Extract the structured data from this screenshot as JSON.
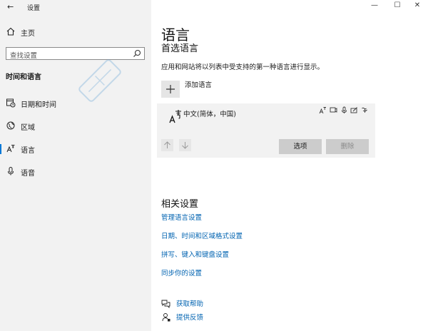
{
  "window": {
    "title": "设置",
    "back_glyph": "←",
    "minimize_glyph": "—",
    "maximize_glyph": "☐",
    "close_glyph": "✕"
  },
  "sidebar": {
    "home_label": "主页",
    "search_placeholder": "查找设置",
    "group_heading": "时间和语言",
    "items": [
      {
        "label": "日期和时间",
        "icon": "calendar-clock-icon"
      },
      {
        "label": "区域",
        "icon": "globe-icon"
      },
      {
        "label": "语言",
        "icon": "language-icon",
        "selected": true
      },
      {
        "label": "语音",
        "icon": "microphone-icon"
      }
    ]
  },
  "main": {
    "title": "语言",
    "subtitle": "首选语言",
    "description": "应用和网站将以列表中受支持的第一种语言进行显示。",
    "add_language_label": "添加语言",
    "language": {
      "name": "中文(简体，中国)",
      "options_label": "选项",
      "remove_label": "删除"
    },
    "related": {
      "heading": "相关设置",
      "links": [
        "管理语言设置",
        "日期、时间和区域格式设置",
        "拼写、键入和键盘设置",
        "同步你的设置"
      ]
    },
    "help": {
      "get_help_label": "获取帮助",
      "feedback_label": "提供反馈"
    }
  },
  "colors": {
    "accent": "#0078d7",
    "link": "#0063b1",
    "sidebar_bg": "#f2f2f2",
    "card_bg": "#f2f2f2"
  }
}
